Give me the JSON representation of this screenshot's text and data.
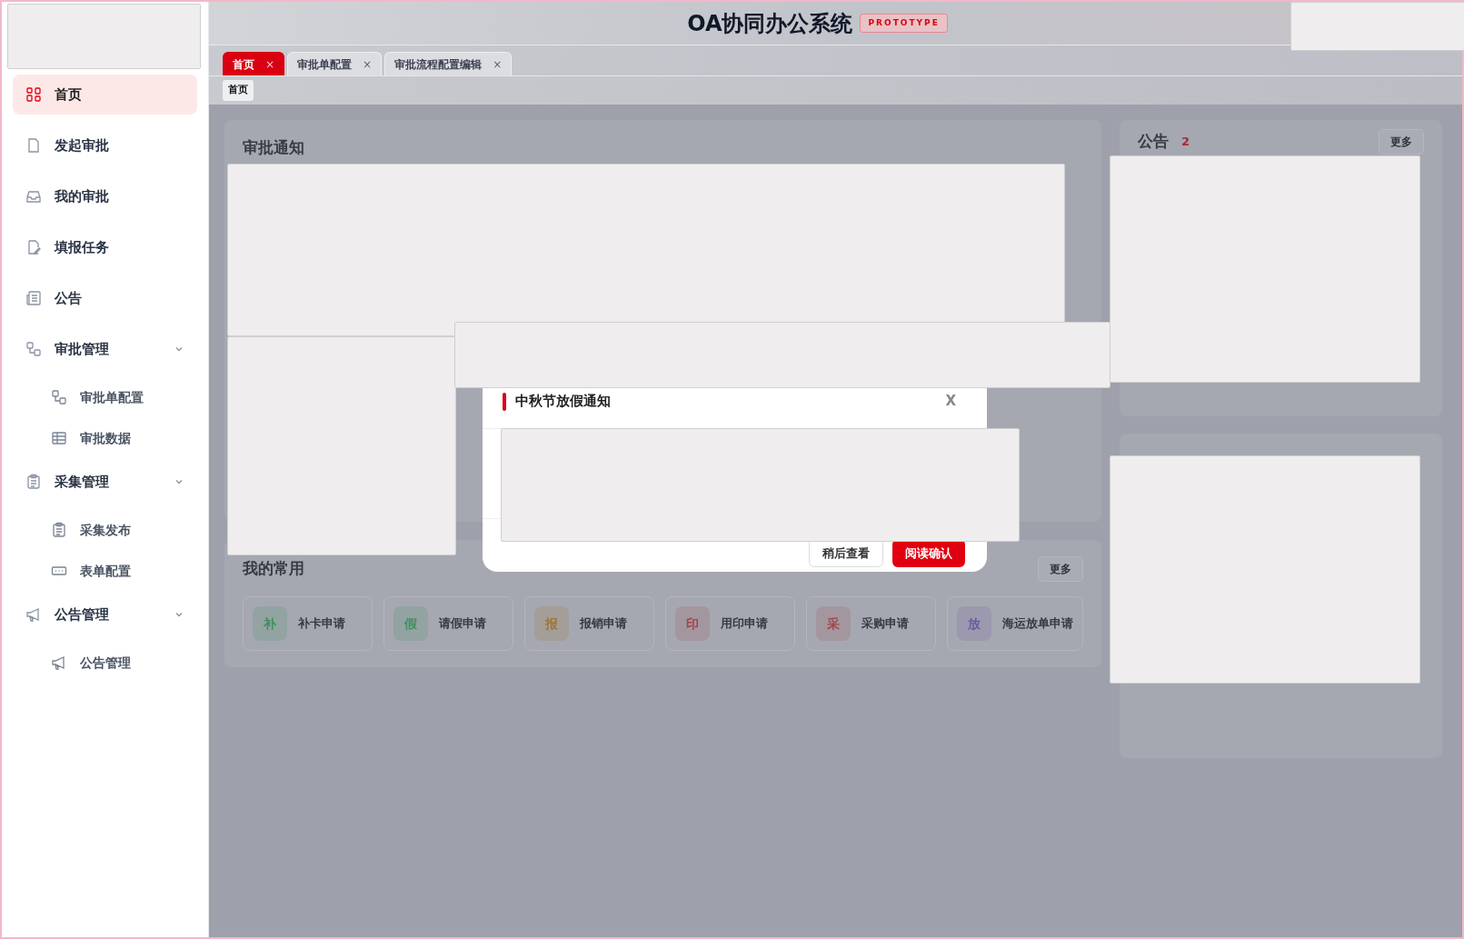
{
  "app": {
    "title": "OA协同办公系统",
    "badge": "PROTOTYPE"
  },
  "sidebar": {
    "items": [
      {
        "label": "首页",
        "selected": true
      },
      {
        "label": "发起审批",
        "selected": false
      },
      {
        "label": "我的审批",
        "selected": false
      },
      {
        "label": "填报任务",
        "selected": false
      },
      {
        "label": "公告",
        "selected": false
      },
      {
        "label": "审批管理",
        "selected": false,
        "expanded": true,
        "children": [
          {
            "label": "审批单配置",
            "selected": false
          },
          {
            "label": "审批数据",
            "selected": false
          }
        ]
      },
      {
        "label": "采集管理",
        "selected": false,
        "expanded": true,
        "children": [
          {
            "label": "采集发布",
            "selected": false
          },
          {
            "label": "表单配置",
            "selected": false
          }
        ]
      },
      {
        "label": "公告管理",
        "selected": false,
        "expanded": true,
        "children": [
          {
            "label": "公告管理",
            "selected": false
          }
        ]
      }
    ]
  },
  "tabs": [
    {
      "label": "首页",
      "selected": true,
      "close": "×"
    },
    {
      "label": "审批单配置",
      "selected": false,
      "close": "×"
    },
    {
      "label": "审批流程配置编辑",
      "selected": false,
      "close": "×"
    }
  ],
  "breadcrumb": [
    "首页"
  ],
  "approval_notice": {
    "title": "审批通知"
  },
  "announcements": {
    "title": "公告",
    "count": "2",
    "more": "更多"
  },
  "favorites": {
    "title": "我的常用",
    "more": "更多",
    "items": [
      {
        "glyph": "补",
        "label": "补卡申请",
        "color": "#3f8f5f"
      },
      {
        "glyph": "假",
        "label": "请假申请",
        "color": "#3f8f5f"
      },
      {
        "glyph": "报",
        "label": "报销申请",
        "color": "#a07632"
      },
      {
        "glyph": "印",
        "label": "用印申请",
        "color": "#a0464b"
      },
      {
        "glyph": "采",
        "label": "采购申请",
        "color": "#a0464b"
      },
      {
        "glyph": "放",
        "label": "海运放单申请",
        "color": "#6e5aa0"
      }
    ]
  },
  "dialog": {
    "title": "中秋节放假通知",
    "close": "X",
    "buttons": [
      {
        "label": "稍后查看",
        "kind": "secondary"
      },
      {
        "label": "阅读确认",
        "kind": "primary"
      }
    ]
  }
}
